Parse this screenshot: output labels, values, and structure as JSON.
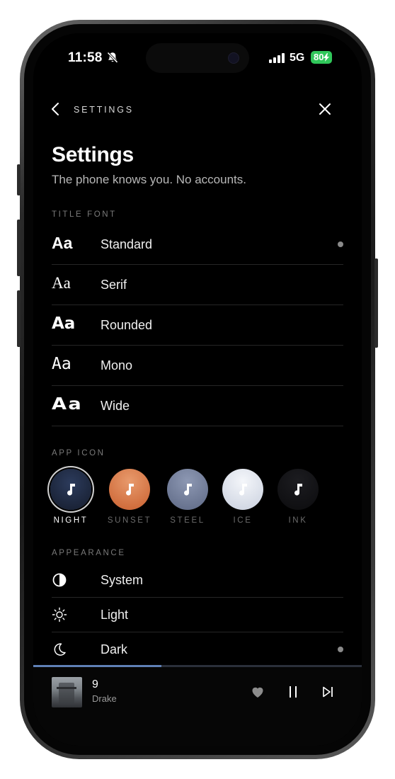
{
  "status_bar": {
    "time": "11:58",
    "network": "5G",
    "battery": "80"
  },
  "nav": {
    "title": "SETTINGS"
  },
  "page": {
    "title": "Settings",
    "subtitle": "The phone knows you. No accounts."
  },
  "title_font": {
    "section_label": "TITLE FONT",
    "sample": "Aa",
    "selected": "Standard",
    "options": [
      {
        "label": "Standard",
        "selected": true
      },
      {
        "label": "Serif",
        "selected": false
      },
      {
        "label": "Rounded",
        "selected": false
      },
      {
        "label": "Mono",
        "selected": false
      },
      {
        "label": "Wide",
        "selected": false
      }
    ]
  },
  "app_icon": {
    "section_label": "APP ICON",
    "selected": "NIGHT",
    "options": [
      {
        "label": "NIGHT",
        "color": "#1e2a44",
        "selected": true
      },
      {
        "label": "SUNSET",
        "color": "#d4703f",
        "selected": false
      },
      {
        "label": "STEEL",
        "color": "#6e7a98",
        "selected": false
      },
      {
        "label": "ICE",
        "color": "#dfe4ee",
        "selected": false
      },
      {
        "label": "INK",
        "color": "#111114",
        "selected": false
      }
    ]
  },
  "appearance": {
    "section_label": "APPEARANCE",
    "selected": "Dark",
    "options": [
      {
        "label": "System",
        "icon": "half-circle-icon",
        "selected": false
      },
      {
        "label": "Light",
        "icon": "sun-icon",
        "selected": false
      },
      {
        "label": "Dark",
        "icon": "moon-icon",
        "selected": true
      }
    ]
  },
  "now_playing": {
    "title": "9",
    "artist": "Drake",
    "progress": 0.39
  },
  "colors": {
    "accent": "#5f80b5",
    "battery": "#30c75a",
    "background": "#000000"
  }
}
